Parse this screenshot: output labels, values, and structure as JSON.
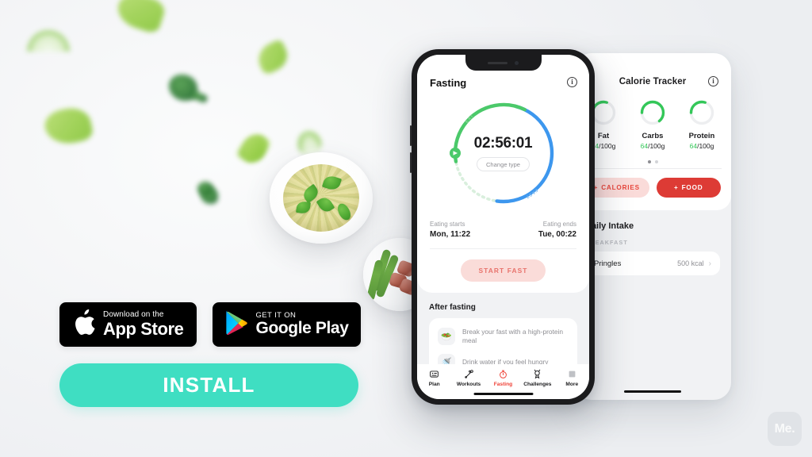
{
  "brand": {
    "watermark": "Me."
  },
  "colors": {
    "background": "#eef0f2",
    "accent_green": "#3fdec2",
    "fast_blue": "#3d97ee",
    "eat_green": "#4bc96a",
    "macro_green": "#34c759",
    "action_red": "#dd3b35",
    "soft_red": "#e8463c",
    "tab_active": "#ef4136"
  },
  "fasting_screen": {
    "title": "Fasting",
    "info_icon": "info-icon",
    "timer": {
      "value": "02:56:01",
      "change_type_label": "Change type",
      "eat_arc_label": "EAT",
      "fast_arc_label": "FAST",
      "eat_percent": 35,
      "fast_percent": 48
    },
    "eating_starts_label": "Eating starts",
    "eating_starts_value": "Mon, 11:22",
    "eating_ends_label": "Eating ends",
    "eating_ends_value": "Tue, 00:22",
    "start_fast_label": "START FAST",
    "after_fasting_heading": "After fasting",
    "tips": [
      {
        "icon": "salad-emoji-icon",
        "glyph": "🥗",
        "text": "Break your fast with a high-protein meal"
      },
      {
        "icon": "faucet-emoji-icon",
        "glyph": "🚿",
        "text": "Drink water if you feel hungry"
      }
    ],
    "tabs": [
      {
        "label": "Plan",
        "icon": "plan-icon",
        "active": false
      },
      {
        "label": "Workouts",
        "icon": "dumbbell-icon",
        "active": false
      },
      {
        "label": "Fasting",
        "icon": "stopwatch-icon",
        "active": true
      },
      {
        "label": "Challenges",
        "icon": "trophy-icon",
        "active": false
      },
      {
        "label": "More",
        "icon": "more-grid-icon",
        "active": false
      }
    ]
  },
  "calorie_screen": {
    "title": "Calorie Tracker",
    "info_icon": "info-icon",
    "macros": [
      {
        "name": "Fat",
        "current": "64",
        "separator": "/",
        "total": "100g",
        "percent": 30
      },
      {
        "name": "Carbs",
        "current": "64",
        "separator": "/",
        "total": "100g",
        "percent": 64
      },
      {
        "name": "Protein",
        "current": "64",
        "separator": "/",
        "total": "100g",
        "percent": 30
      }
    ],
    "pager": {
      "count": 2,
      "active_index": 0
    },
    "buttons": [
      {
        "label": "CALORIES",
        "plus": "+",
        "style": "soft"
      },
      {
        "label": "FOOD",
        "plus": "+",
        "style": "solid"
      }
    ],
    "daily_intake_heading": "Daily Intake",
    "meal_section": "BREAKFAST",
    "entries": [
      {
        "name": "Pringles",
        "kcal": "500 kcal",
        "chevron": "›"
      }
    ]
  },
  "store_badges": [
    {
      "id": "app-store",
      "icon": "apple-logo-icon",
      "small": "Download on the",
      "big": "App Store"
    },
    {
      "id": "google-play",
      "icon": "google-play-icon",
      "small": "GET IT ON",
      "big": "Google Play"
    }
  ],
  "install_button": {
    "label": "INSTALL"
  },
  "decor": {
    "pasta_photo": "pesto-pasta-plate",
    "asparagus_photo": "bacon-wrapped-asparagus-plate",
    "confetti": "blurred-green-vegetables"
  }
}
